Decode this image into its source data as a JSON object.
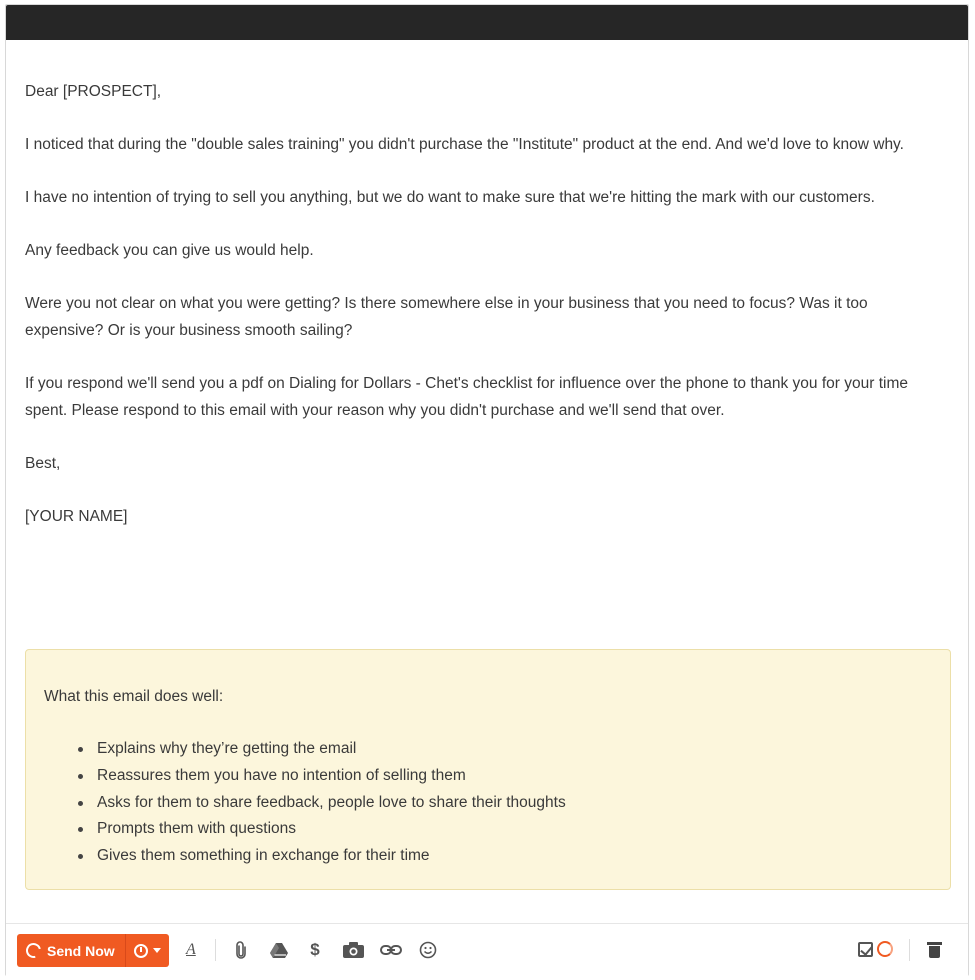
{
  "email": {
    "greeting": "Dear [PROSPECT],",
    "paragraphs": [
      "I noticed that during the \"double sales training\" you didn't purchase the \"Institute\" product at the end. And we'd love to know why.",
      "I have no intention of trying to sell you anything, but we do want to make sure that we're hitting the mark with our customers.",
      "Any feedback you can give us would help.",
      "Were you not clear on what you were getting? Is there somewhere else in your business that you need to focus? Was it too expensive? Or is your business smooth sailing?",
      "If you respond we'll send you a pdf on Dialing for Dollars - Chet's checklist for influence over the phone to thank you for your time spent. Please respond to this email with your reason why you didn't purchase and we'll send that over."
    ],
    "signoff": "Best,",
    "signature": "[YOUR NAME]"
  },
  "callout": {
    "heading": "What this email does well:",
    "items": [
      "Explains why they’re getting the email",
      "Reassures them you have no intention of selling them",
      "Asks for them to share feedback, people love to share their thoughts",
      "Prompts them with questions",
      "Gives them something in exchange for their time"
    ]
  },
  "toolbar": {
    "send_label": "Send Now",
    "format_glyph": "A",
    "attach_glyph": "📎",
    "drive_glyph": "▲",
    "dollar_glyph": "$",
    "camera_glyph": "📷",
    "link_glyph": "∞",
    "emoji_glyph": "☺",
    "icons": [
      "send-icon",
      "clock-icon",
      "caret-down-icon",
      "text-format-icon",
      "paperclip-icon",
      "google-drive-icon",
      "dollar-icon",
      "camera-icon",
      "link-icon",
      "emoji-icon",
      "checkbox-icon",
      "tracking-icon",
      "trash-icon"
    ]
  },
  "colors": {
    "titlebar": "#262626",
    "accent": "#f05a22",
    "callout_bg": "#fcf6dc",
    "callout_border": "#ecdfa8"
  }
}
